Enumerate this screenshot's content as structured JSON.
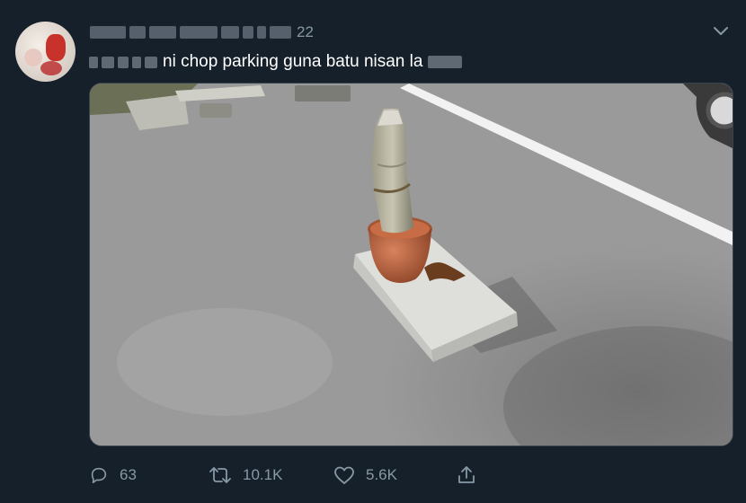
{
  "tweet": {
    "timestamp": "22",
    "text_visible": "ni chop parking guna batu nisan la",
    "photo_alt_icon": "photo"
  },
  "actions": {
    "reply_count": "63",
    "retweet_count": "10.1K",
    "like_count": "5.6K"
  },
  "icons": {
    "reply": "reply-icon",
    "retweet": "retweet-icon",
    "like": "heart-icon",
    "share": "share-icon",
    "menu": "chevron-down-icon"
  },
  "colors": {
    "background": "#15202b",
    "text": "#ffffff",
    "muted": "#8899a6"
  }
}
